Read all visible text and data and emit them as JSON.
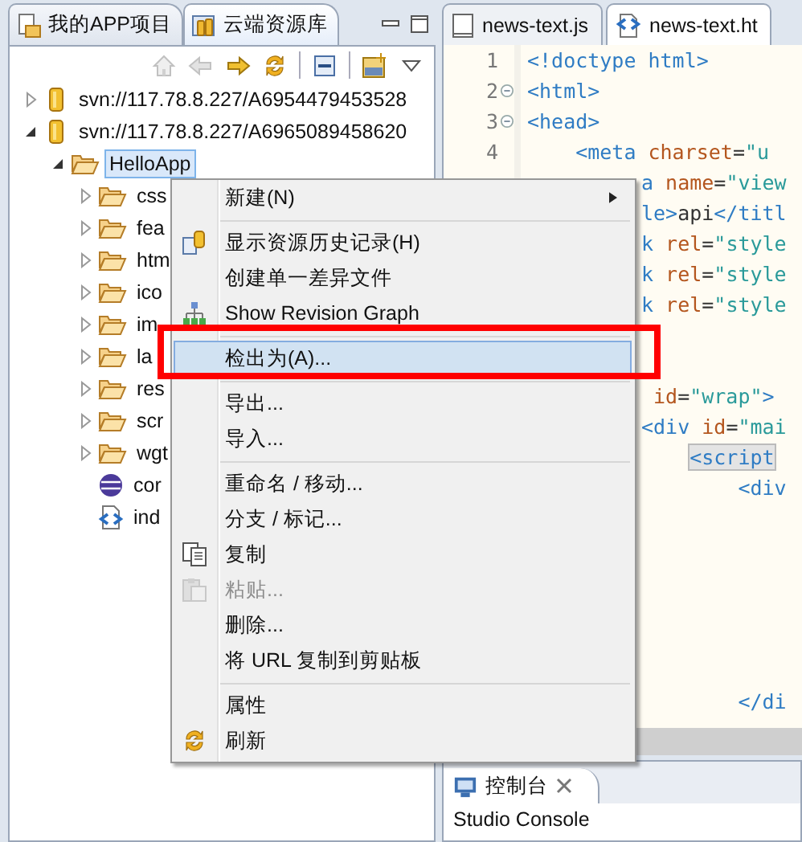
{
  "left_view": {
    "tabs": [
      {
        "label": "我的APP项目",
        "selected": false
      },
      {
        "label": "云端资源库",
        "selected": true
      }
    ],
    "toolbar": [
      {
        "disabled": true
      },
      {
        "disabled": true
      },
      {
        "disabled": false
      },
      {
        "disabled": false
      },
      {
        "disabled": false
      },
      {
        "disabled": false
      },
      {
        "disabled": false
      }
    ],
    "tree": [
      {
        "label": "svn://117.78.8.227/A6954479453528",
        "kind": "repo",
        "expanded": false,
        "selected": false
      },
      {
        "label": "svn://117.78.8.227/A6965089458620",
        "kind": "repo",
        "expanded": true,
        "selected": false,
        "children": [
          {
            "label": "HelloApp",
            "kind": "project",
            "expanded": true,
            "selected": true,
            "children": [
              {
                "label": "css",
                "kind": "folder",
                "expanded": false,
                "selected": false
              },
              {
                "label": "fea",
                "kind": "folder",
                "expanded": false,
                "selected": false
              },
              {
                "label": "htm",
                "kind": "folder",
                "expanded": false,
                "selected": false
              },
              {
                "label": "ico",
                "kind": "folder",
                "expanded": false,
                "selected": false
              },
              {
                "label": "im",
                "kind": "folder",
                "expanded": false,
                "selected": false
              },
              {
                "label": "la",
                "kind": "folder",
                "expanded": false,
                "selected": false
              },
              {
                "label": "res",
                "kind": "folder",
                "expanded": false,
                "selected": false
              },
              {
                "label": "scr",
                "kind": "folder",
                "expanded": false,
                "selected": false
              },
              {
                "label": "wgt",
                "kind": "folder",
                "expanded": false,
                "selected": false
              },
              {
                "label": "cor",
                "kind": "config-file",
                "selected": false
              },
              {
                "label": "ind",
                "kind": "html-file",
                "selected": false
              }
            ]
          }
        ]
      }
    ]
  },
  "editor": {
    "tabs": [
      {
        "label": "news-text.js",
        "kind": "js",
        "selected": false
      },
      {
        "label": "news-text.ht",
        "kind": "html",
        "selected": true
      }
    ],
    "lines": [
      {
        "number": "1",
        "fold": false,
        "tokens": [
          {
            "text": "<!doctype html>",
            "kind": "tag"
          }
        ]
      },
      {
        "number": "2",
        "fold": true,
        "tokens": [
          {
            "text": "<html>",
            "kind": "tag"
          }
        ]
      },
      {
        "number": "3",
        "fold": true,
        "tokens": [
          {
            "text": "<head>",
            "kind": "tag"
          }
        ]
      },
      {
        "number": "4",
        "fold": false,
        "tokens": [
          {
            "text": "    <meta",
            "kind": "tag"
          },
          {
            "text": " charset",
            "kind": "attr"
          },
          {
            "text": "=",
            "kind": "plain"
          },
          {
            "text": "\"u",
            "kind": "value"
          }
        ]
      },
      {
        "tokens": [
          {
            "text": "a",
            "kind": "tag"
          },
          {
            "text": " name",
            "kind": "attr"
          },
          {
            "text": "=",
            "kind": "plain"
          },
          {
            "text": "\"view",
            "kind": "value"
          }
        ]
      },
      {
        "tokens": [
          {
            "text": "le>",
            "kind": "tag"
          },
          {
            "text": "api",
            "kind": "plain"
          },
          {
            "text": "</titl",
            "kind": "tag"
          }
        ]
      },
      {
        "tokens": [
          {
            "text": "k",
            "kind": "tag"
          },
          {
            "text": " rel",
            "kind": "attr"
          },
          {
            "text": "=",
            "kind": "plain"
          },
          {
            "text": "\"style",
            "kind": "value"
          }
        ]
      },
      {
        "tokens": [
          {
            "text": "k",
            "kind": "tag"
          },
          {
            "text": " rel",
            "kind": "attr"
          },
          {
            "text": "=",
            "kind": "plain"
          },
          {
            "text": "\"style",
            "kind": "value"
          }
        ]
      },
      {
        "tokens": [
          {
            "text": "k",
            "kind": "tag"
          },
          {
            "text": " rel",
            "kind": "attr"
          },
          {
            "text": "=",
            "kind": "plain"
          },
          {
            "text": "\"style",
            "kind": "value"
          }
        ]
      },
      {
        "kind": "blank"
      },
      {
        "kind": "blank"
      },
      {
        "tokens": [
          {
            "text": " id",
            "kind": "attr"
          },
          {
            "text": "=",
            "kind": "plain"
          },
          {
            "text": "\"wrap\"",
            "kind": "value"
          },
          {
            "text": ">",
            "kind": "tag"
          }
        ]
      },
      {
        "tokens": [
          {
            "text": "<div",
            "kind": "tag"
          },
          {
            "text": " id",
            "kind": "attr"
          },
          {
            "text": "=",
            "kind": "plain"
          },
          {
            "text": "\"mai",
            "kind": "value"
          }
        ]
      },
      {
        "tokens": [
          {
            "text": "    <script",
            "kind": "tag",
            "marked": true
          }
        ]
      },
      {
        "tokens": [
          {
            "text": "        <div",
            "kind": "tag"
          }
        ]
      },
      {
        "kind": "blank"
      },
      {
        "kind": "blank"
      },
      {
        "kind": "blank"
      },
      {
        "kind": "blank"
      },
      {
        "kind": "blank"
      },
      {
        "kind": "blank"
      },
      {
        "tokens": [
          {
            "text": "        </di",
            "kind": "tag"
          }
        ]
      }
    ]
  },
  "context_menu": {
    "items": [
      {
        "kind": "item",
        "label": "新建(N)",
        "submenu": true,
        "disabled": false,
        "selected": false,
        "annotated": false
      },
      {
        "kind": "separator"
      },
      {
        "kind": "item",
        "label": "显示资源历史记录(H)",
        "disabled": false,
        "selected": false,
        "annotated": false
      },
      {
        "kind": "item",
        "label": "创建单一差异文件",
        "disabled": false,
        "selected": false,
        "annotated": false
      },
      {
        "kind": "item",
        "label": "Show Revision Graph",
        "disabled": false,
        "selected": false,
        "annotated": false
      },
      {
        "kind": "separator"
      },
      {
        "kind": "item",
        "label": "检出为(A)...",
        "disabled": false,
        "selected": true,
        "annotated": true
      },
      {
        "kind": "separator"
      },
      {
        "kind": "item",
        "label": "导出...",
        "disabled": false,
        "selected": false,
        "annotated": false
      },
      {
        "kind": "item",
        "label": "导入...",
        "disabled": false,
        "selected": false,
        "annotated": false
      },
      {
        "kind": "separator"
      },
      {
        "kind": "item",
        "label": "重命名 / 移动...",
        "disabled": false,
        "selected": false,
        "annotated": false
      },
      {
        "kind": "item",
        "label": "分支 / 标记...",
        "disabled": false,
        "selected": false,
        "annotated": false
      },
      {
        "kind": "item",
        "label": "复制",
        "disabled": false,
        "selected": false,
        "annotated": false
      },
      {
        "kind": "item",
        "label": "粘贴...",
        "disabled": true,
        "selected": false,
        "annotated": false
      },
      {
        "kind": "item",
        "label": "删除...",
        "disabled": false,
        "selected": false,
        "annotated": false
      },
      {
        "kind": "item",
        "label": "将 URL 复制到剪贴板",
        "disabled": false,
        "selected": false,
        "annotated": false
      },
      {
        "kind": "separator"
      },
      {
        "kind": "item",
        "label": "属性",
        "disabled": false,
        "selected": false,
        "annotated": false
      },
      {
        "kind": "item",
        "label": "刷新",
        "disabled": false,
        "selected": false,
        "annotated": false
      }
    ]
  },
  "console": {
    "tab": "控制台",
    "title": "Studio Console"
  }
}
